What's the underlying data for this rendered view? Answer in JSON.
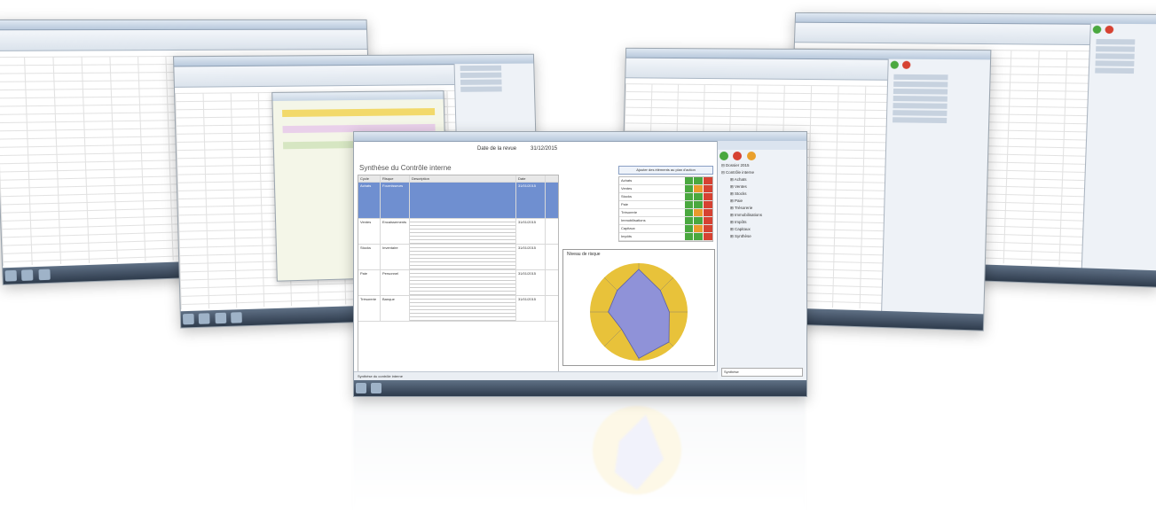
{
  "main_window": {
    "sheet_title": "Synthèse du Contrôle interne",
    "header_label": "Date de la revue",
    "header_value": "31/12/2015",
    "action_button": "Ajouter des éléments au plan d'action",
    "radar_title": "Niveau de risque",
    "status_bar": "Synthèse du contrôle interne",
    "columns": [
      "Cycle",
      "Risque",
      "Description",
      "Date",
      ""
    ],
    "rows": [
      {
        "cycle": "Achats",
        "risque": "Fournisseurs",
        "date": "31/01/2015",
        "highlight": true
      },
      {
        "cycle": "Ventes",
        "risque": "Encaissements",
        "date": "31/01/2015",
        "highlight": false
      },
      {
        "cycle": "Stocks",
        "risque": "Inventaire",
        "date": "31/01/2015",
        "highlight": false
      },
      {
        "cycle": "Paie",
        "risque": "Personnel",
        "date": "31/01/2015",
        "highlight": false
      },
      {
        "cycle": "Trésorerie",
        "risque": "Banque",
        "date": "31/01/2015",
        "highlight": false
      }
    ],
    "cycles": [
      "Achats",
      "Ventes",
      "Stocks",
      "Paie",
      "Trésorerie",
      "Immobilisations",
      "Capitaux",
      "Impôts"
    ],
    "tree_items": [
      "Dossier 2015",
      "Contrôle interne",
      "Achats",
      "Ventes",
      "Stocks",
      "Paie",
      "Trésorerie",
      "Immobilisations",
      "Impôts",
      "Capitaux",
      "Synthèse"
    ],
    "bottom_input_value": "Synthèse"
  },
  "colors": {
    "accent_blue": "#6f8fd0",
    "radar_yellow": "#e8c23a",
    "radar_fill": "#8f92d8",
    "status_green": "#4aa83f",
    "status_red": "#d64232",
    "status_orange": "#e99a2c",
    "taskbar": "#3b4a5d"
  },
  "chart_data": {
    "type": "radar",
    "title": "Niveau de risque",
    "categories": [
      "Achats",
      "Ventes",
      "Stocks",
      "Paie",
      "Trésorerie",
      "Immobilisations",
      "Capitaux",
      "Impôts"
    ],
    "values": [
      3.5,
      2.5,
      2.5,
      3.5,
      3.8,
      2.0,
      2.5,
      2.5
    ],
    "max": 4
  },
  "icons": [
    "green-check-icon",
    "red-stop-icon",
    "pencil-icon",
    "folder-icon",
    "excel-icon"
  ]
}
